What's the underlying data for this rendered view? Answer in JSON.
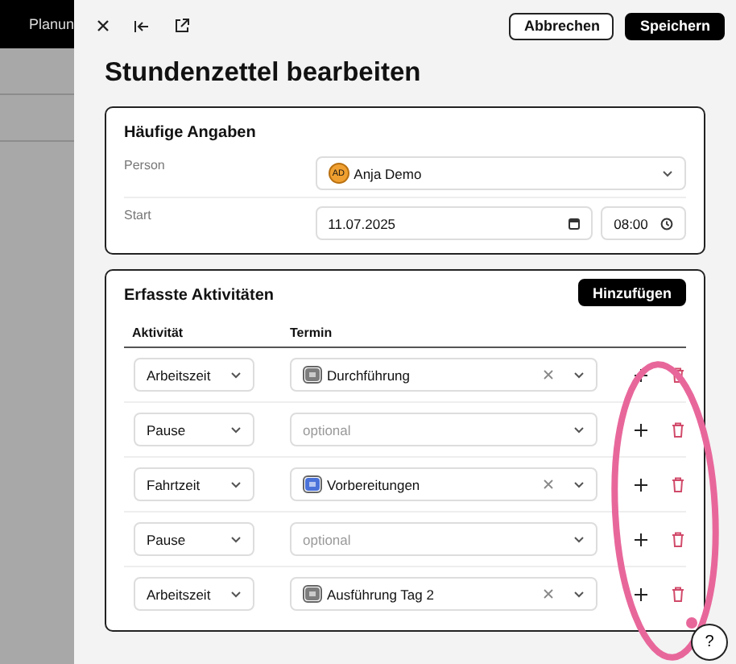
{
  "background_app": {
    "nav_item": "Planun"
  },
  "toolbar": {
    "buttons": [
      {
        "label": "Abbrechen",
        "kind": "secondary"
      },
      {
        "label": "Speichern",
        "kind": "primary"
      }
    ]
  },
  "title": "Stundenzettel bearbeiten",
  "common": {
    "heading": "Häufige Angaben",
    "person": {
      "label": "Person",
      "initials": "AD",
      "value": "Anja Demo"
    },
    "start": {
      "label": "Start",
      "date": "11.07.2025",
      "time": "08:00"
    }
  },
  "activities": {
    "heading": "Erfasste Aktivitäten",
    "add_button": "Hinzufügen",
    "columns": [
      "Aktivität",
      "Termin"
    ],
    "rows": [
      {
        "activity": "Arbeitszeit",
        "appointment": "Durchführung",
        "color": "#7d7d7d"
      },
      {
        "activity": "Pause",
        "placeholder": "optional"
      },
      {
        "activity": "Fahrtzeit",
        "appointment": "Vorbereitungen",
        "color": "#4a72d9"
      },
      {
        "activity": "Pause",
        "placeholder": "optional"
      },
      {
        "activity": "Arbeitszeit",
        "appointment": "Ausführung Tag 2",
        "color": "#7d7d7d"
      }
    ]
  },
  "help": "?"
}
